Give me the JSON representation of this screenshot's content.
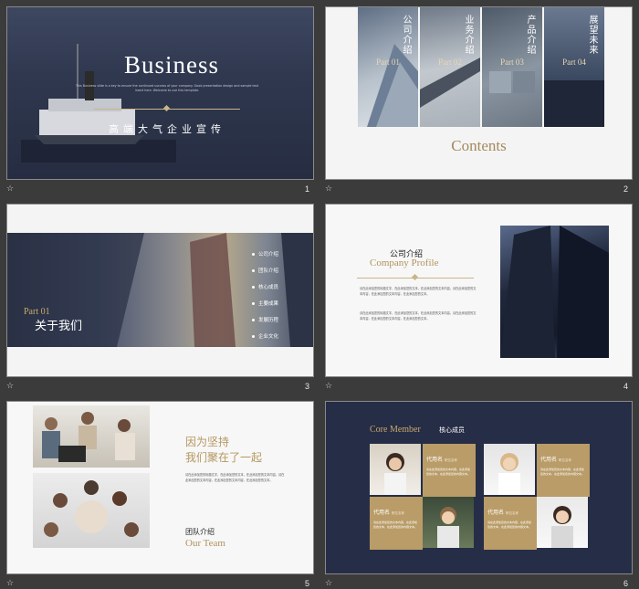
{
  "slides": [
    {
      "number": "1",
      "title": "Business",
      "subtitle": "This Business slide is a key to ensure the continued success of your company. Good presentation design and sample text insert here. Welcome to use this template.",
      "cn_title": "高端大气企业宣传"
    },
    {
      "number": "2",
      "panels": [
        {
          "cn": "公司介绍",
          "en": "Part 01"
        },
        {
          "cn": "业务介绍",
          "en": "Part 02"
        },
        {
          "cn": "产品介绍",
          "en": "Part 03"
        },
        {
          "cn": "展望未来",
          "en": "Part 04"
        }
      ],
      "contents": "Contents"
    },
    {
      "number": "3",
      "part": "Part 01",
      "title": "关于我们",
      "menu": [
        "公司介绍",
        "团队介绍",
        "核心成员",
        "主要成果",
        "发展历程",
        "企业文化"
      ]
    },
    {
      "number": "4",
      "cn_title": "公司介绍",
      "en_title": "Company Profile",
      "para_a": "请在此添加您的标题文字，在此添加您的文本，在此添加您的文本内容。请在此添加您的文本内容，在此添加您的文本内容，在此添加您的文本。",
      "para_b": "请在此添加您的标题文字，在此添加您的文本，在此添加您的文本内容。请在此添加您的文本内容，在此添加您的文本内容，在此添加您的文本。"
    },
    {
      "number": "5",
      "head_line1": "因为坚持",
      "head_line2": "我们聚在了一起",
      "para": "请在此添加您的标题文字，在此添加您的文本，在此添加您的文本内容。请在此添加您的文本内容，在此添加您的文本内容，在此添加您的文本。",
      "team_cn": "团队介绍",
      "team_en": "Our Team"
    },
    {
      "number": "6",
      "core_en": "Core Member",
      "core_cn": "核心成员",
      "members": [
        {
          "name": "代用名",
          "title": "职位名称",
          "text": "请在此添加您的文本内容，在此添加您的文本，在此添加您的内容文本。"
        },
        {
          "name": "代用名",
          "title": "职位名称",
          "text": "请在此添加您的文本内容，在此添加您的文本，在此添加您的内容文本。"
        },
        {
          "name": "代用名",
          "title": "职位名称",
          "text": "请在此添加您的文本内容，在此添加您的文本，在此添加您的内容文本。"
        },
        {
          "name": "代用名",
          "title": "职位名称",
          "text": "请在此添加您的文本内容，在此添加您的文本，在此添加您的内容文本。"
        }
      ]
    }
  ],
  "footer_icon": "☆"
}
